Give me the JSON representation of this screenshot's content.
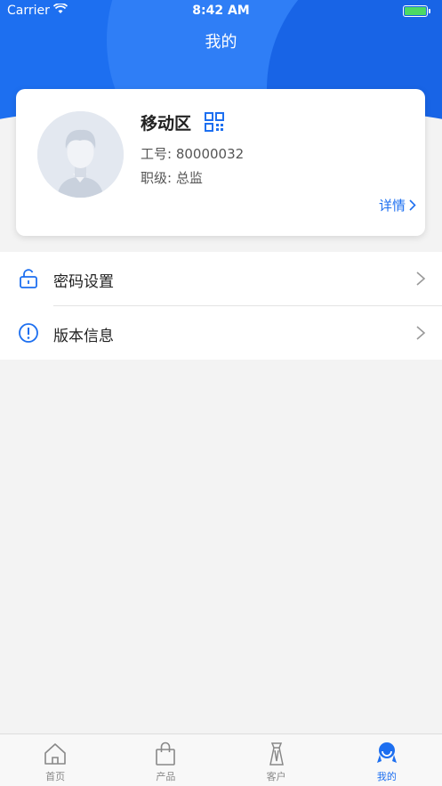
{
  "status_bar": {
    "carrier": "Carrier",
    "time": "8:42 AM"
  },
  "page_title": "我的",
  "profile": {
    "name": "移动区",
    "employee_id_label": "工号:",
    "employee_id": "80000032",
    "rank_label": "职级:",
    "rank": "总监",
    "detail_label": "详情"
  },
  "menu": {
    "items": [
      {
        "label": "密码设置",
        "icon": "unlock-icon"
      },
      {
        "label": "版本信息",
        "icon": "info-icon"
      }
    ]
  },
  "tabbar": {
    "tabs": [
      {
        "label": "首页",
        "icon": "home-icon",
        "active": false
      },
      {
        "label": "产品",
        "icon": "bag-icon",
        "active": false
      },
      {
        "label": "客户",
        "icon": "customer-icon",
        "active": false
      },
      {
        "label": "我的",
        "icon": "user-icon",
        "active": true
      }
    ]
  },
  "colors": {
    "accent": "#1d6ff0",
    "battery": "#4cd964"
  }
}
